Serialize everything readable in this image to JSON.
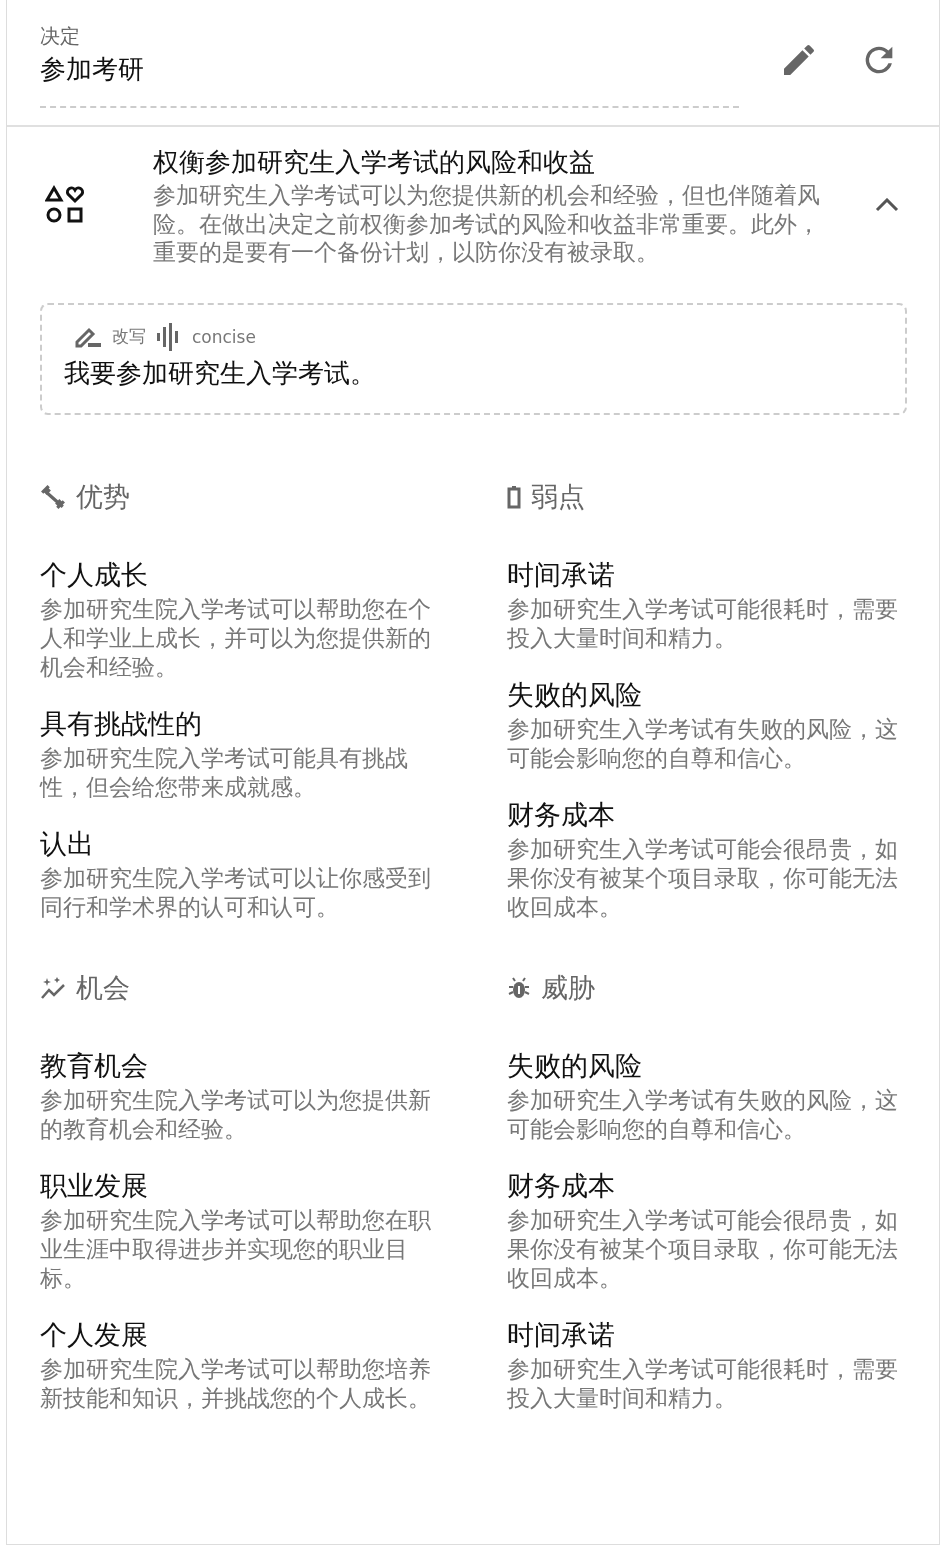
{
  "decision": {
    "label": "决定",
    "value": "参加考研"
  },
  "summary": {
    "title": "权衡参加研究生入学考试的风险和收益",
    "text": "参加研究生入学考试可以为您提供新的机会和经验，但也伴随着风险。在做出决定之前权衡参加考试的风险和收益非常重要。此外，重要的是要有一个备份计划，以防你没有被录取。",
    "expanded": true
  },
  "rewrite": {
    "mode": "改写",
    "tone": "concise",
    "text": "我要参加研究生入学考试。"
  },
  "sections": [
    {
      "kind": "strengths",
      "title": "优势",
      "items": [
        {
          "title": "个人成长",
          "text": "参加研究生院入学考试可以帮助您在个人和学业上成长，并可以为您提供新的机会和经验。"
        },
        {
          "title": "具有挑战性的",
          "text": "参加研究生院入学考试可能具有挑战性，但会给您带来成就感。"
        },
        {
          "title": "认出",
          "text": "参加研究生院入学考试可以让你感受到同行和学术界的认可和认可。"
        }
      ]
    },
    {
      "kind": "weaknesses",
      "title": "弱点",
      "items": [
        {
          "title": "时间承诺",
          "text": "参加研究生入学考试可能很耗时，需要投入大量时间和精力。"
        },
        {
          "title": "失败的风险",
          "text": "参加研究生入学考试有失败的风险，这可能会影响您的自尊和信心。"
        },
        {
          "title": "财务成本",
          "text": "参加研究生入学考试可能会很昂贵，如果你没有被某个项目录取，你可能无法收回成本。"
        }
      ]
    },
    {
      "kind": "opportunities",
      "title": "机会",
      "items": [
        {
          "title": "教育机会",
          "text": "参加研究生院入学考试可以为您提供新的教育机会和经验。"
        },
        {
          "title": "职业发展",
          "text": "参加研究生院入学考试可以帮助您在职业生涯中取得进步并实现您的职业目标。"
        },
        {
          "title": "个人发展",
          "text": "参加研究生院入学考试可以帮助您培养新技能和知识，并挑战您的个人成长。"
        }
      ]
    },
    {
      "kind": "threats",
      "title": "威胁",
      "items": [
        {
          "title": "失败的风险",
          "text": "参加研究生入学考试有失败的风险，这可能会影响您的自尊和信心。"
        },
        {
          "title": "财务成本",
          "text": "参加研究生入学考试可能会很昂贵，如果你没有被某个项目录取，你可能无法收回成本。"
        },
        {
          "title": "时间承诺",
          "text": "参加研究生入学考试可能很耗时，需要投入大量时间和精力。"
        }
      ]
    }
  ]
}
